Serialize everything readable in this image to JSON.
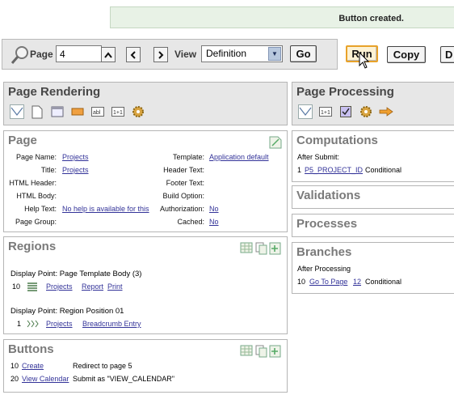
{
  "message": {
    "text": "Button created."
  },
  "toolbar": {
    "page_label": "Page",
    "page_value": "4",
    "view_label": "View",
    "view_value": "Definition",
    "go_label": "Go",
    "run_label": "Run",
    "copy_label": "Copy",
    "next_btn_partial": "D"
  },
  "rendering": {
    "title": "Page Rendering"
  },
  "processing": {
    "title": "Page Processing"
  },
  "page": {
    "title": "Page",
    "left": [
      {
        "label": "Page Name:",
        "value": "Projects",
        "link": true
      },
      {
        "label": "Title:",
        "value": "Projects",
        "link": true
      },
      {
        "label": "HTML Header:",
        "value": "",
        "link": false
      },
      {
        "label": "HTML Body:",
        "value": "",
        "link": false
      },
      {
        "label": "Help Text:",
        "value": "No help is available for this",
        "link": true
      },
      {
        "label": "Page Group:",
        "value": "",
        "link": false
      }
    ],
    "right": [
      {
        "label": "Template:",
        "value": "Application default",
        "link": true
      },
      {
        "label": "Header Text:",
        "value": "",
        "link": false
      },
      {
        "label": "Footer Text:",
        "value": "",
        "link": false
      },
      {
        "label": "Build Option:",
        "value": "",
        "link": false
      },
      {
        "label": "Authorization:",
        "value": "No",
        "link": true
      },
      {
        "label": "Cached:",
        "value": "No",
        "link": true
      }
    ]
  },
  "regions": {
    "title": "Regions",
    "group1_title": "Display Point: Page Template Body (3)",
    "r1": {
      "seq": "10",
      "name": "Projects",
      "l1": "Report",
      "l2": "Print"
    },
    "group2_title": "Display Point: Region Position 01",
    "r2": {
      "seq": "1",
      "name": "Projects",
      "l1": "Breadcrumb Entry"
    }
  },
  "buttons": {
    "title": "Buttons",
    "rows": [
      {
        "seq": "10",
        "name": "Create",
        "desc": "Redirect to page 5"
      },
      {
        "seq": "20",
        "name": "View Calendar",
        "desc": "Submit as \"VIEW_CALENDAR\""
      }
    ]
  },
  "computations": {
    "title": "Computations",
    "sub": "After Submit:",
    "seq": "1",
    "item": "P5_PROJECT_ID",
    "cond": "Conditional"
  },
  "validations": {
    "title": "Validations"
  },
  "processes": {
    "title": "Processes"
  },
  "branches": {
    "title": "Branches",
    "sub": "After Processing",
    "seq": "10",
    "item": "Go To Page",
    "page": "12",
    "cond": "Conditional"
  },
  "colors": {
    "accent": "#e8a229",
    "link": "#333399",
    "panel": "#e7e7e7",
    "success": "#e8f2e6"
  }
}
